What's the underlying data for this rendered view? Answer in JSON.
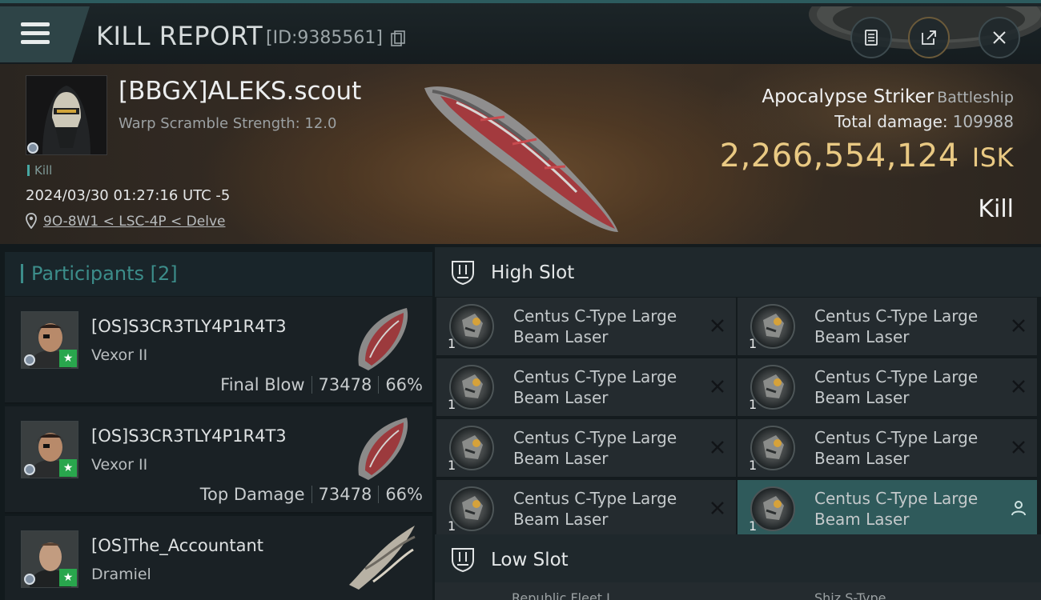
{
  "header": {
    "title": "KILL REPORT",
    "kill_id": "[ID:9385561]",
    "icons": [
      "menu-icon",
      "copy-icon",
      "clipboard-icon",
      "share-icon",
      "close-icon"
    ]
  },
  "victim": {
    "name": "[BBGX]ALEKS.scout",
    "warp_scramble": "Warp Scramble Strength: 12.0",
    "kill_tag": "Kill",
    "datetime": "2024/03/30 01:27:16 UTC -5",
    "location": "9O-8W1 < LSC-4P < Delve"
  },
  "ship": {
    "name": "Apocalypse Striker",
    "class": "Battleship",
    "total_damage_label": "Total damage:",
    "total_damage_value": "109988",
    "isk_value": "2,266,554,124",
    "isk_unit": "ISK",
    "result": "Kill"
  },
  "participants": {
    "title": "Participants [2]",
    "rows": [
      {
        "name": "[OS]S3CR3TLY4P1R4T3",
        "ship": "Vexor II",
        "role": "Final Blow",
        "damage": "73478",
        "percent": "66%"
      },
      {
        "name": "[OS]S3CR3TLY4P1R4T3",
        "ship": "Vexor II",
        "role": "Top Damage",
        "damage": "73478",
        "percent": "66%"
      },
      {
        "name": "[OS]The_Accountant",
        "ship": "Dramiel",
        "role": "",
        "damage": "",
        "percent": ""
      }
    ]
  },
  "high_slot": {
    "title": "High Slot",
    "modules": [
      {
        "line1": "Centus C-Type Large",
        "line2": "Beam Laser",
        "qty": "1"
      },
      {
        "line1": "Centus C-Type Large",
        "line2": "Beam Laser",
        "qty": "1"
      },
      {
        "line1": "Centus C-Type Large",
        "line2": "Beam Laser",
        "qty": "1"
      },
      {
        "line1": "Centus C-Type Large",
        "line2": "Beam Laser",
        "qty": "1"
      },
      {
        "line1": "Centus C-Type Large",
        "line2": "Beam Laser",
        "qty": "1"
      },
      {
        "line1": "Centus C-Type Large",
        "line2": "Beam Laser",
        "qty": "1"
      },
      {
        "line1": "Centus C-Type Large",
        "line2": "Beam Laser",
        "qty": "1"
      },
      {
        "line1": "Centus C-Type Large",
        "line2": "Beam Laser",
        "qty": "1"
      }
    ]
  },
  "low_slot": {
    "title": "Low Slot",
    "partial_items": [
      "Republic Fleet L...",
      "Shiz S-Type..."
    ]
  },
  "colors": {
    "accent": "#3c8d8a",
    "isk_gold": "#e9c983",
    "highlight_row": "#2f5a5b",
    "star_green": "#29a64d"
  }
}
